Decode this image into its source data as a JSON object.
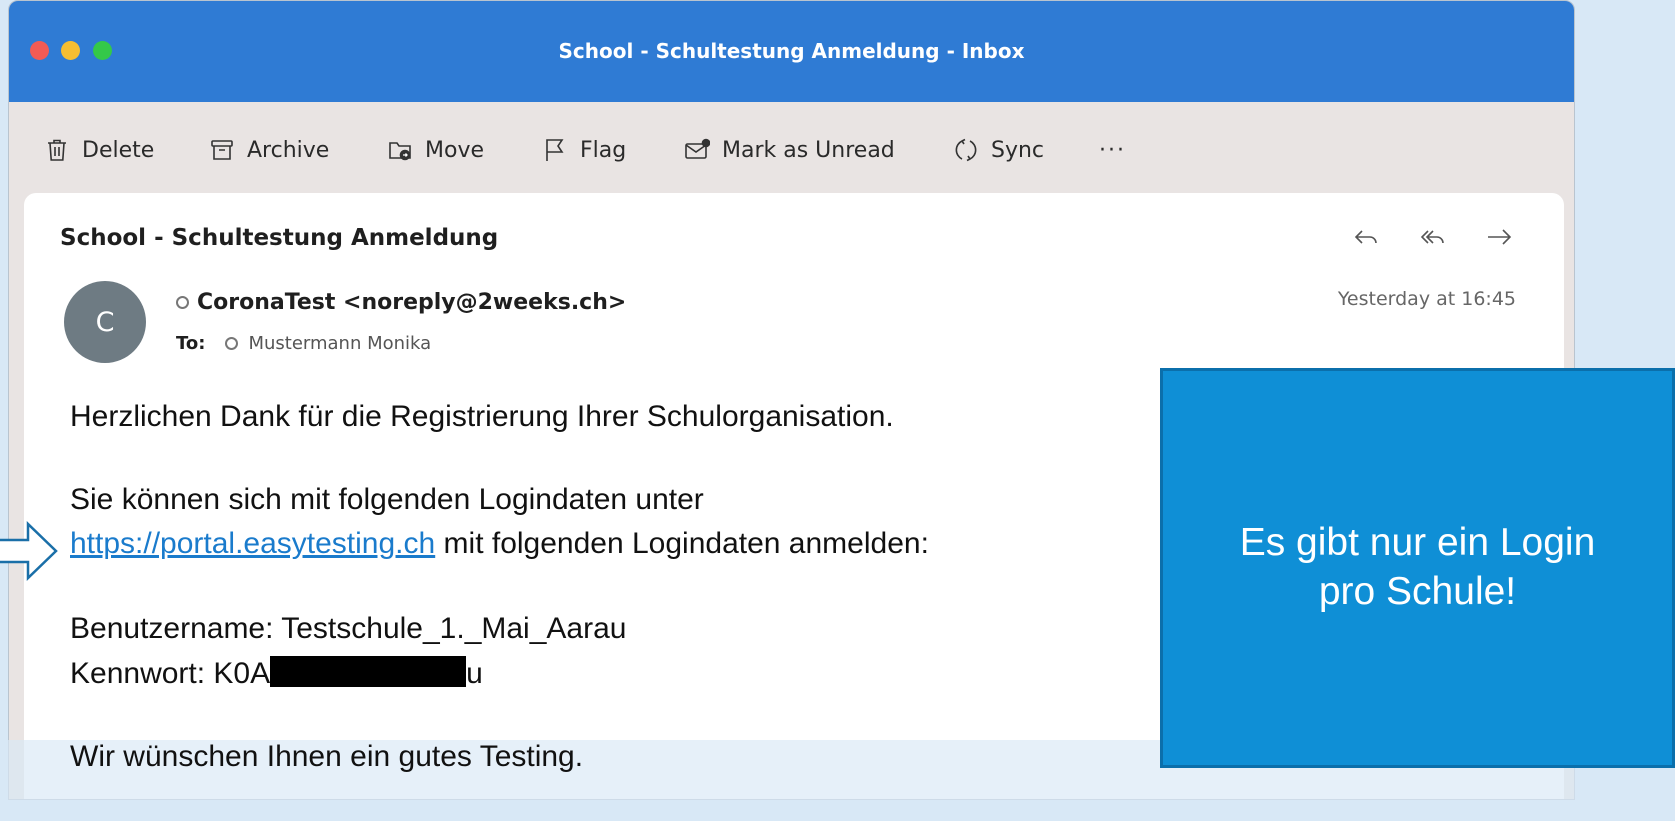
{
  "window": {
    "title": "School - Schultestung Anmeldung - Inbox"
  },
  "toolbar": {
    "delete": "Delete",
    "archive": "Archive",
    "move": "Move",
    "flag": "Flag",
    "mark_unread": "Mark as Unread",
    "sync": "Sync",
    "more": "···"
  },
  "message": {
    "subject": "School - Schultestung Anmeldung",
    "avatar_initial": "C",
    "from": "CoronaTest <noreply@2weeks.ch>",
    "to_label": "To:",
    "to": "Mustermann Monika",
    "date": "Yesterday at 16:45",
    "actions": [
      "reply-icon",
      "reply-all-icon",
      "forward-icon"
    ]
  },
  "body": {
    "thanks": "Herzlichen Dank für die Registrierung Ihrer Schulorganisation.",
    "intro": "Sie können sich mit folgenden Logindaten unter",
    "link": "https://portal.easytesting.ch",
    "link_suffix": " mit folgenden Logindaten anmelden:",
    "username": "Benutzername: Testschule_1._Mai_Aarau",
    "password_prefix": "Kennwort: K0A",
    "password_suffix": "u",
    "wish": "Wir wünschen Ihnen ein gutes Testing."
  },
  "callout": {
    "text": "Es gibt nur ein Login pro Schule!"
  },
  "colors": {
    "titlebar": "#2f7bd4",
    "callout": "#0f8fd6",
    "link": "#1a7bcc",
    "background": "#d8e8f6"
  }
}
